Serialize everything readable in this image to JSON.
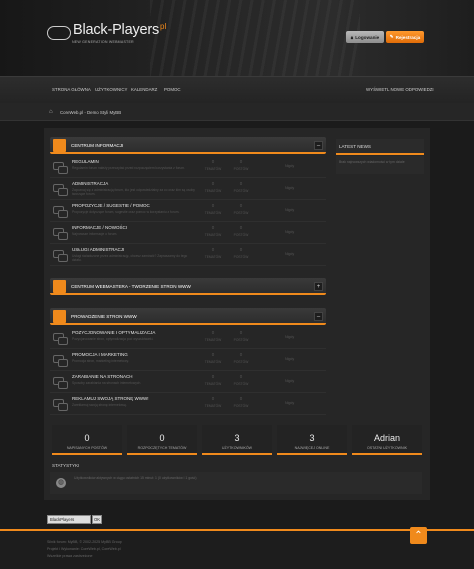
{
  "header": {
    "logo_title": "Black-Players",
    "logo_tld": "pl",
    "logo_sub": "NEW GENERATION WEBMASTER",
    "login_label": "Logowanie",
    "register_label": "Rejestracja"
  },
  "nav": {
    "items": [
      "STRONA GŁÓWNA",
      "UŻYTKOWNICY",
      "KALENDARZ",
      "POMOC"
    ],
    "right": "WYŚWIETL NOWE ODPOWIEDZI"
  },
  "breadcrumb": "CoreWeb.pl - Demo Styli MyBB",
  "categories": [
    {
      "title": "CENTRUM INFORMACJI",
      "toggle": "–",
      "forums": [
        {
          "title": "REGULAMIN",
          "desc": "Regulamin forum należy przeczytać przed rozpoczęciem korzystania z forum.",
          "topics": "0",
          "posts": "0",
          "last": "Nigdy"
        },
        {
          "title": "ADMINISTRACJA",
          "desc": "Zapoznaj się z administracją forum, kto jest odpowiedzialny za co oraz kim są osoby tworzące forum.",
          "topics": "0",
          "posts": "0",
          "last": "Nigdy"
        },
        {
          "title": "PROPOZYCJE / SUGESTIE / POMOC",
          "desc": "Propozycje dotyczące forum, sugestie oraz pomoc w korzystaniu z forum.",
          "topics": "0",
          "posts": "0",
          "last": "Nigdy"
        },
        {
          "title": "INFORMACJE / NOWOŚCI",
          "desc": "Najnowsze informacje o forum.",
          "topics": "0",
          "posts": "0",
          "last": "Nigdy"
        },
        {
          "title": "USŁUGI ADMINISTRACJI",
          "desc": "Usługi świadczone przez administrację, chcesz zamówić? Zapraszamy do tego działu.",
          "topics": "0",
          "posts": "0",
          "last": "Nigdy"
        }
      ]
    },
    {
      "title": "CENTRUM WEBMASTERA - TWORZENIE STRON WWW",
      "toggle": "+",
      "forums": []
    },
    {
      "title": "PROWADZENIE STRON WWW",
      "toggle": "–",
      "forums": [
        {
          "title": "POZYCJONOWANIE I OPTYMALIZACJA",
          "desc": "Pozycjonowanie stron, optymalizacja pod wyszukiwarki.",
          "topics": "0",
          "posts": "0",
          "last": "Nigdy"
        },
        {
          "title": "PROMOCJA I MARKETING",
          "desc": "Promocja stron, marketing internetowy.",
          "topics": "0",
          "posts": "0",
          "last": "Nigdy"
        },
        {
          "title": "ZARABIANIE NA STRONACH",
          "desc": "Sposoby zarabiania na stronach internetowych.",
          "topics": "0",
          "posts": "0",
          "last": "Nigdy"
        },
        {
          "title": "REKLAMUJ SWOJĄ STRONĘ WWW!",
          "desc": "Zareklamuj swoją stronę internetową.",
          "topics": "0",
          "posts": "0",
          "last": "Nigdy"
        }
      ]
    }
  ],
  "col_labels": {
    "topics": "TEMATÓW",
    "posts": "POSTÓW"
  },
  "sidebar": {
    "title": "LATEST NEWS",
    "body": "Brak najnowszych wiadomości w tym dziale"
  },
  "stats": [
    {
      "value": "0",
      "label": "NAPISANYCH POSTÓW"
    },
    {
      "value": "0",
      "label": "ROZPOCZĘTYCH TEMATÓW"
    },
    {
      "value": "3",
      "label": "UŻYTKOWNIKÓW"
    },
    {
      "value": "3",
      "label": "NAJWIĘCEJ ONLINE"
    },
    {
      "value": "Adrian",
      "label": "OSTATNI UŻYTKOWNIK"
    }
  ],
  "statystyki": {
    "title": "STATYSTYKI",
    "text": "Użytkowników aktywnych w ciągu ostatnich 15 minut: 1 (0 użytkowników i 1 gość)"
  },
  "theme_select": {
    "value": "BlackPlayers",
    "ok": "OK"
  },
  "footer": {
    "line1": "Silnik forum: MyBB, © 2002-2025 MyBB Group",
    "line2": "Projekt i Wykonanie: CoreWeb.pl, CoreWeb.pl",
    "line3": "Wszelkie prawa zastrzeżone"
  },
  "accent_color": "#f08a1c"
}
